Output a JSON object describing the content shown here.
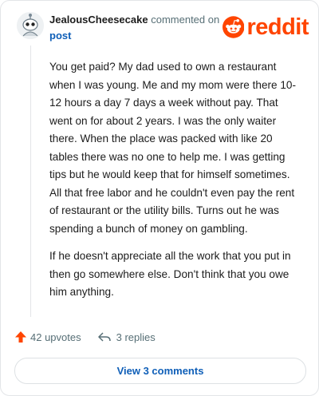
{
  "comment": {
    "author": "JealousCheesecake",
    "action_text": "commented on",
    "post_link": "post",
    "paragraphs": [
      "You get paid? My dad used to own a restaurant when I was young. Me and my mom were there 10-12 hours a day 7 days a week without pay. That went on for about 2 years. I was the only waiter there. When the place was packed with like 20 tables there was no one to help me. I was getting tips but he would keep that for himself sometimes. All that free labor and he couldn't even pay the rent of restaurant or the utility bills. Turns out he was spending a bunch of money on gambling.",
      "If he doesn't appreciate all the work that you put in then go somewhere else. Don't think that you owe him anything."
    ]
  },
  "brand": {
    "wordmark": "reddit",
    "color": "#ff4500"
  },
  "actions": {
    "upvotes_label": "42 upvotes",
    "replies_label": "3 replies",
    "view_comments_label": "View 3 comments"
  }
}
